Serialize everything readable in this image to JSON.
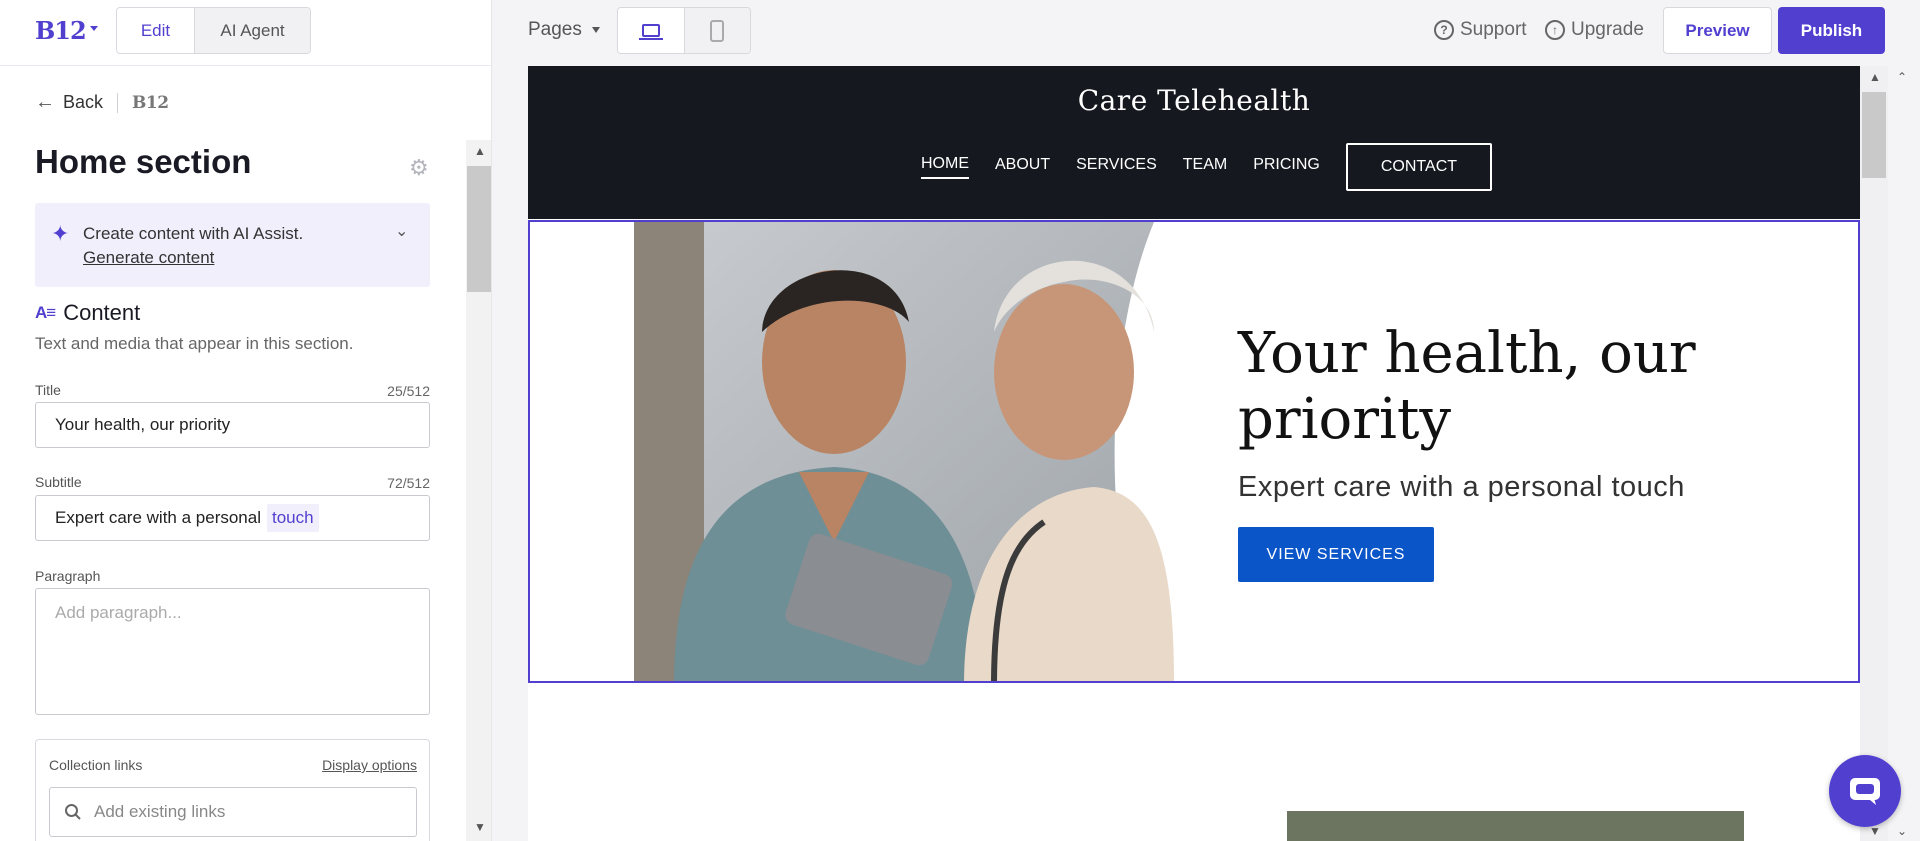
{
  "app": {
    "logo": "B12",
    "modes": [
      "Edit",
      "AI Agent"
    ],
    "active_mode": "Edit"
  },
  "breadcrumb": {
    "back_label": "Back",
    "site_logo": "B12"
  },
  "panel": {
    "title": "Home section",
    "ai_assist": {
      "text": "Create content with AI Assist.",
      "link": "Generate content"
    },
    "content": {
      "label": "Content",
      "description": "Text and media that appear in this section."
    },
    "fields": {
      "title": {
        "label": "Title",
        "count": "25/512",
        "value": "Your health, our priority"
      },
      "subtitle": {
        "label": "Subtitle",
        "count": "72/512",
        "value_prefix": "Expert care with a personal",
        "value_highlight": "touch"
      },
      "paragraph": {
        "label": "Paragraph",
        "placeholder": "Add paragraph..."
      }
    },
    "collection": {
      "label": "Collection links",
      "options_link": "Display options",
      "search_placeholder": "Add existing links"
    }
  },
  "toolbar": {
    "pages_label": "Pages",
    "support_label": "Support",
    "upgrade_label": "Upgrade",
    "preview_label": "Preview",
    "publish_label": "Publish"
  },
  "site": {
    "title": "Care Telehealth",
    "nav": [
      "HOME",
      "ABOUT",
      "SERVICES",
      "TEAM",
      "PRICING"
    ],
    "nav_active": "HOME",
    "nav_cta": "CONTACT",
    "hero": {
      "heading": "Your health, our priority",
      "subtitle": "Expert care with a personal touch",
      "cta": "VIEW SERVICES"
    }
  },
  "colors": {
    "brand": "#5140d0",
    "site_header": "#15191f",
    "cta_blue": "#0a55c8"
  }
}
